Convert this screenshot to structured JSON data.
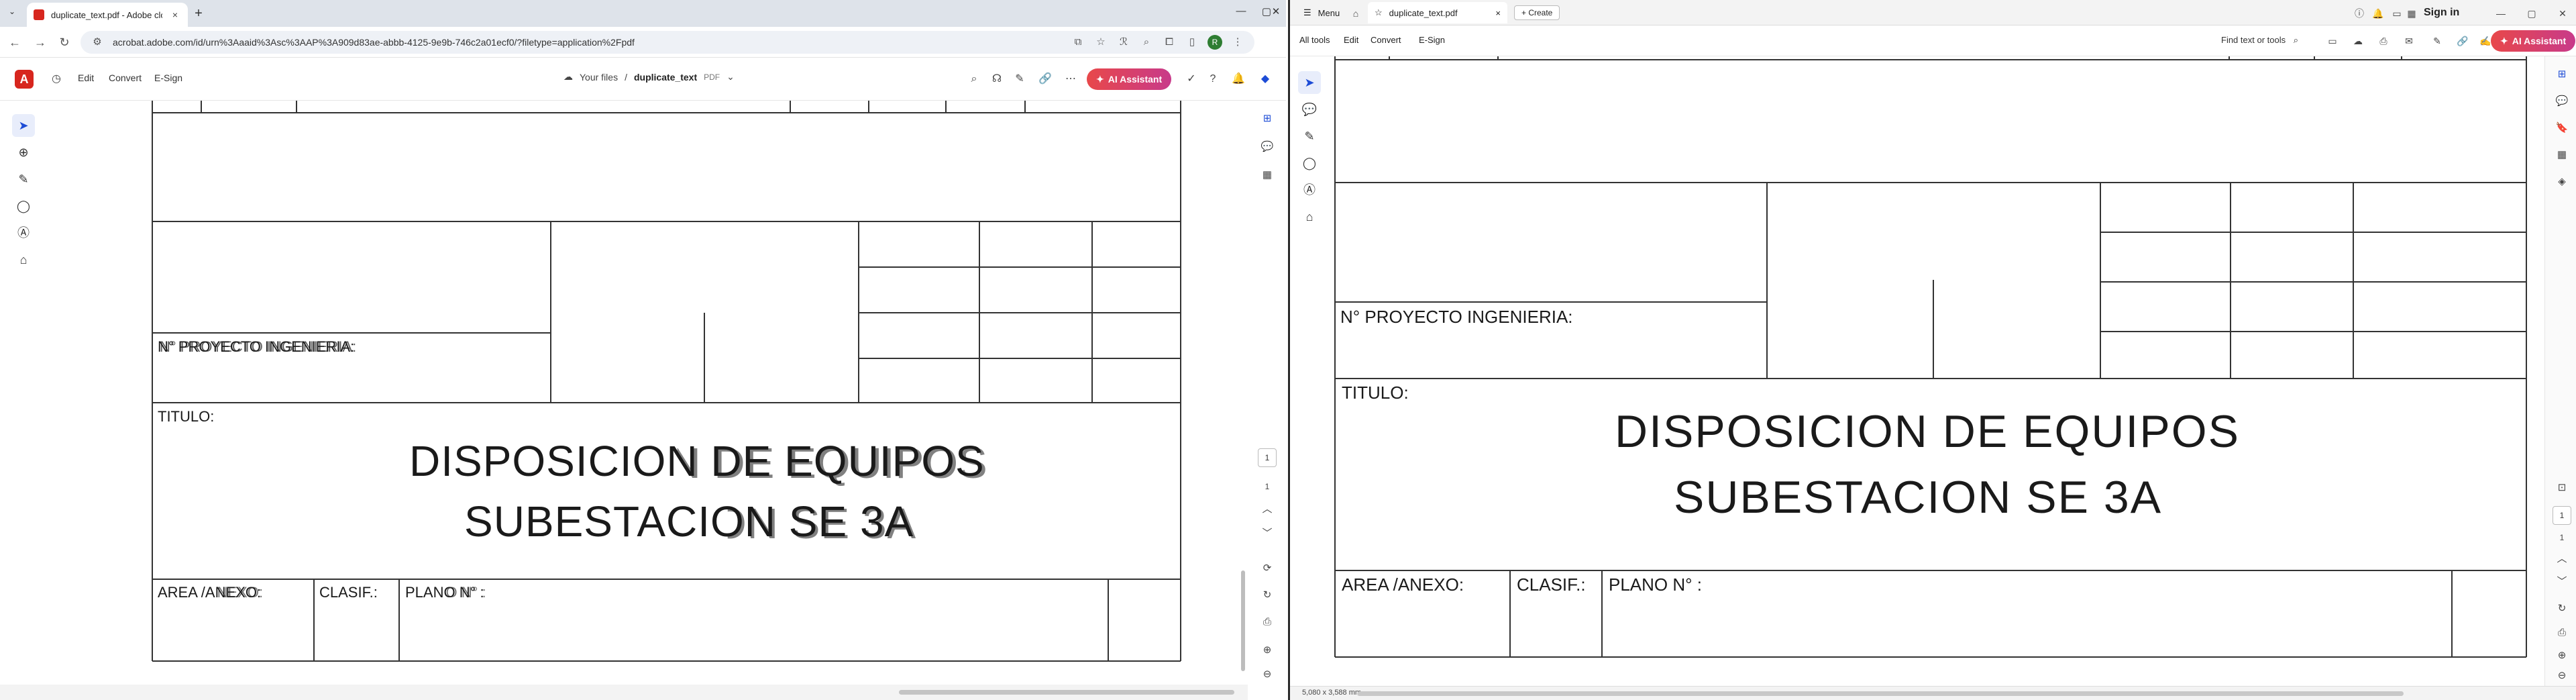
{
  "left_browser": {
    "tab_title": "duplicate_text.pdf - Adobe clo",
    "tab_close": "×",
    "new_tab": "+",
    "tab_menu": "⌄",
    "window_controls": [
      "—",
      "▢",
      "✕"
    ],
    "url": "acrobat.adobe.com/id/urn%3Aaaid%3Asc%3AAP%3A909d83ae-abbb-4125-9e9b-746c2a01ecf0/?filetype=application%2Fpdf",
    "nav": {
      "back": "←",
      "forward": "→",
      "reload": "↻"
    },
    "profile_initial": "R",
    "menu_dots": "⋮"
  },
  "left_acrobat": {
    "logo": "A",
    "menu": {
      "edit": "Edit",
      "convert": "Convert",
      "esign": "E-Sign"
    },
    "breadcrumb": {
      "root": "Your files",
      "separator": "/",
      "file": "duplicate_text",
      "ext": "PDF"
    },
    "ai_assistant": "AI Assistant",
    "page_number": "1",
    "page_total": "1"
  },
  "right_app": {
    "menu_label": "Menu",
    "tab_title": "duplicate_text.pdf",
    "tab_close": "×",
    "create_label": "+ Create",
    "sign_in": "Sign in",
    "toolbar": {
      "all_tools": "All tools",
      "edit": "Edit",
      "convert": "Convert",
      "esign": "E-Sign"
    },
    "find": "Find text or tools",
    "ai_assistant": "AI Assistant",
    "status_dims": "5,080 x 3,588 mm",
    "page_number": "1",
    "page_total": "1",
    "window_controls": [
      "—",
      "▢",
      "✕"
    ]
  },
  "drawing": {
    "proyecto": "N° PROYECTO INGENIERIA:",
    "proyecto_overlay_1": "N° PROYECTO INGENIERIA:",
    "titulo": "TITULO:",
    "line1": "DISPOSICION  DE  EQUIPOS",
    "line2": "SUBESTACION  SE  3A",
    "area": "AREA /ANEXO:",
    "clasif": "CLASIF.:",
    "plano": "PLANO  N° :"
  }
}
